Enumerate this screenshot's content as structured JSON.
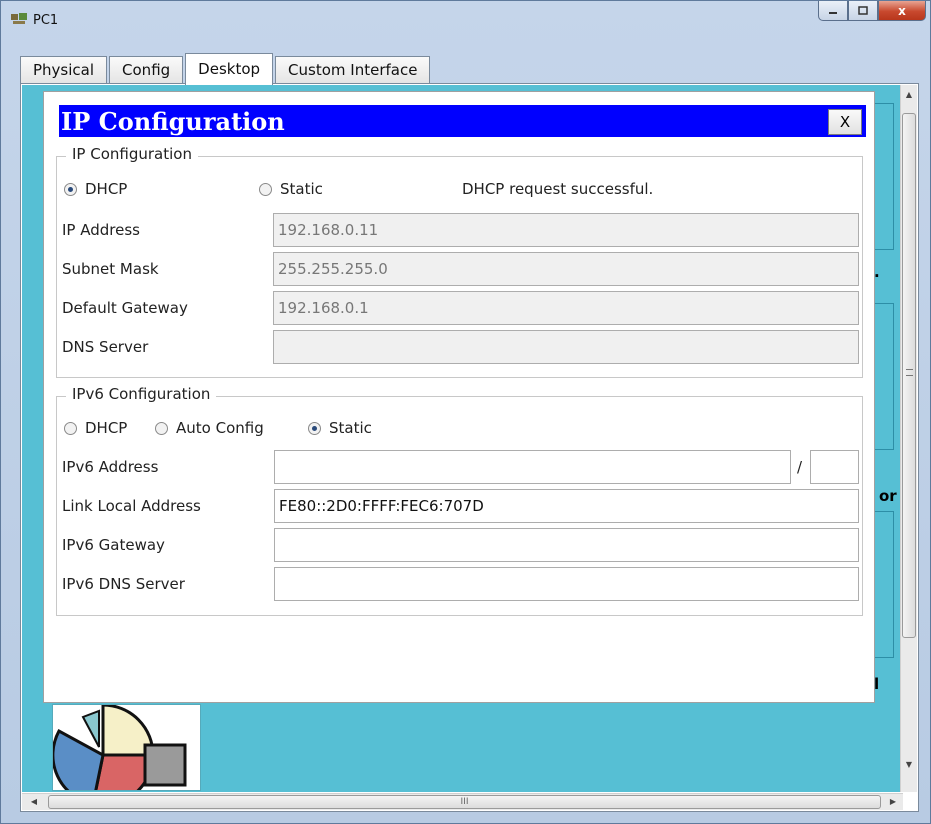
{
  "window": {
    "title": "PC1",
    "minimize_icon": "minimize-icon",
    "maximize_icon": "maximize-icon",
    "close_label": "x"
  },
  "tabs": [
    {
      "label": "Physical"
    },
    {
      "label": "Config"
    },
    {
      "label": "Desktop",
      "active": true
    },
    {
      "label": "Custom Interface"
    }
  ],
  "desktop_partial": {
    "label_1": ".",
    "label_2": "or",
    "label_3": "l"
  },
  "horizontal_scrollbar": {
    "thumb_grip": "III"
  },
  "dialog": {
    "title": "IP Configuration",
    "close_label": "X",
    "ipv4": {
      "legend": "IP Configuration",
      "dhcp_label": "DHCP",
      "static_label": "Static",
      "mode": "DHCP",
      "status": "DHCP request successful.",
      "ip_address": {
        "label": "IP Address",
        "value": "192.168.0.11"
      },
      "subnet_mask": {
        "label": "Subnet Mask",
        "value": "255.255.255.0"
      },
      "default_gateway": {
        "label": "Default Gateway",
        "value": "192.168.0.1"
      },
      "dns_server": {
        "label": "DNS Server",
        "value": ""
      }
    },
    "ipv6": {
      "legend": "IPv6 Configuration",
      "dhcp_label": "DHCP",
      "auto_label": "Auto Config",
      "static_label": "Static",
      "mode": "Static",
      "address": {
        "label": "IPv6 Address",
        "value": "",
        "prefix_separator": "/",
        "prefix": ""
      },
      "link_local": {
        "label": "Link Local Address",
        "value": "FE80::2D0:FFFF:FEC6:707D"
      },
      "gateway": {
        "label": "IPv6 Gateway",
        "value": ""
      },
      "dns_server": {
        "label": "IPv6 DNS Server",
        "value": ""
      }
    }
  },
  "colors": {
    "title_bar_blue": "#0000ff",
    "desktop_bg": "#56bfd4",
    "close_red": "#c8492e"
  }
}
